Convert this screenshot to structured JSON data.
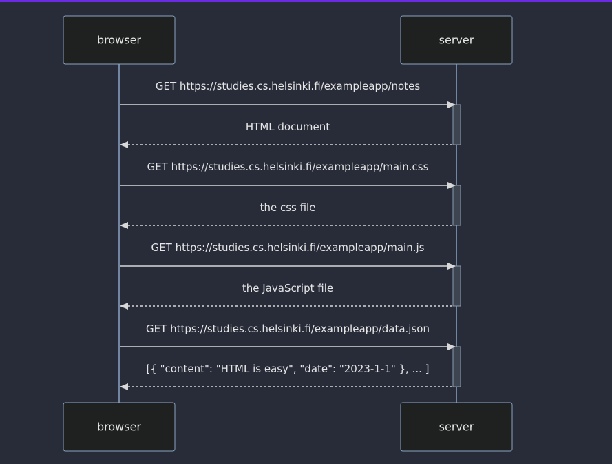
{
  "participants": [
    {
      "id": "browser",
      "label": "browser"
    },
    {
      "id": "server",
      "label": "server"
    }
  ],
  "messages": [
    {
      "from": "browser",
      "to": "server",
      "label": "GET https://studies.cs.helsinki.fi/exampleapp/notes",
      "style": "solid"
    },
    {
      "from": "server",
      "to": "browser",
      "label": "HTML document",
      "style": "dashed"
    },
    {
      "from": "browser",
      "to": "server",
      "label": "GET https://studies.cs.helsinki.fi/exampleapp/main.css",
      "style": "solid"
    },
    {
      "from": "server",
      "to": "browser",
      "label": "the css file",
      "style": "dashed"
    },
    {
      "from": "browser",
      "to": "server",
      "label": "GET https://studies.cs.helsinki.fi/exampleapp/main.js",
      "style": "solid"
    },
    {
      "from": "server",
      "to": "browser",
      "label": "the JavaScript file",
      "style": "dashed"
    },
    {
      "from": "browser",
      "to": "server",
      "label": "GET https://studies.cs.helsinki.fi/exampleapp/data.json",
      "style": "solid"
    },
    {
      "from": "server",
      "to": "browser",
      "label": "[{ \"content\": \"HTML is easy\", \"date\": \"2023-1-1\" }, ... ]",
      "style": "dashed"
    }
  ],
  "colors": {
    "background": "#282c39",
    "accent_bar": "#6a2be2",
    "actor_fill": "#1f2020",
    "actor_stroke": "#8aa4c4",
    "lifeline": "#8aa4c4",
    "activation_fill": "#3d4551",
    "activation_stroke": "#8a9aae",
    "arrow": "#d8d8d8",
    "text": "#e6e6e6"
  }
}
